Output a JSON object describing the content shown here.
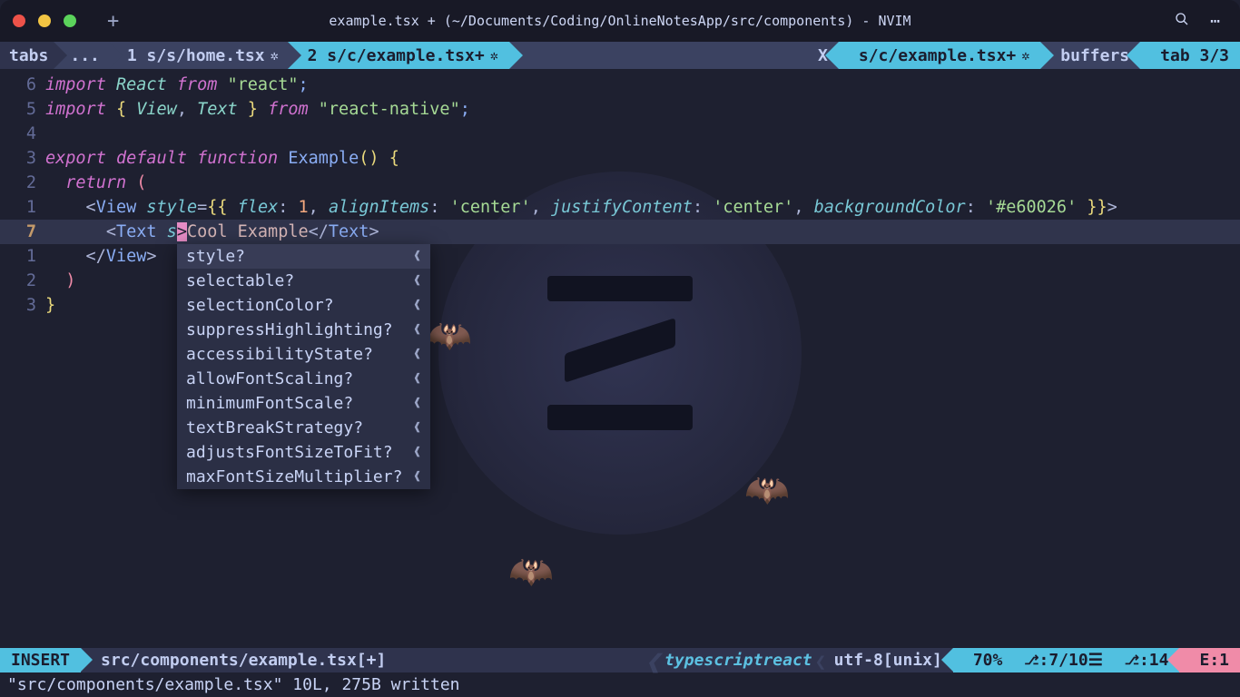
{
  "window": {
    "title": "example.tsx + (~/Documents/Coding/OnlineNotesApp/src/components) - NVIM"
  },
  "tabline": {
    "tabs_label": "tabs",
    "ellipsis": "...",
    "tab1": "1 s/s/home.tsx ",
    "tab2": "2 s/c/example.tsx+ ",
    "close": "X",
    "right_file": "s/c/example.tsx+ ",
    "buffers_label": "buffers",
    "tab_count": "tab 3/3"
  },
  "gutter": [
    "6",
    "5",
    "4",
    "3",
    "2",
    "1",
    "7",
    "1",
    "2",
    "3"
  ],
  "code": {
    "l0": {
      "a": "import ",
      "b": "React ",
      "c": "from ",
      "d": "\"react\"",
      "e": ";"
    },
    "l1": {
      "a": "import ",
      "b": "{ ",
      "c": "View",
      "d": ", ",
      "e": "Text ",
      "f": "} ",
      "g": "from ",
      "h": "\"react-native\"",
      "i": ";"
    },
    "l3": {
      "a": "export ",
      "b": "default ",
      "c": "function ",
      "d": "Example",
      "e": "() {"
    },
    "l4": {
      "a": "  return ",
      "b": "("
    },
    "l5": {
      "a": "    <",
      "b": "View ",
      "c": "style",
      "d": "=",
      "e": "{{ ",
      "f": "flex",
      "g": ": ",
      "h": "1",
      "i": ", ",
      "j": "alignItems",
      "k": ": ",
      "l": "'center'",
      "m": ", ",
      "n": "justifyContent",
      "o": ": ",
      "p": "'center'",
      "q": ", ",
      "r": "backgroundColor",
      "s": ": ",
      "t": "'#e60026'",
      "u": " }}",
      "v": ">"
    },
    "l6": {
      "a": "      <",
      "b": "Text ",
      "c": "s",
      "d": ">",
      "e": "Cool Example",
      "f": "</",
      "g": "Text",
      "h": ">"
    },
    "l7": {
      "a": "    </",
      "b": "View",
      "c": ">"
    },
    "l8": {
      "a": "  )"
    },
    "l9": {
      "a": "}"
    }
  },
  "completion": [
    "style?",
    "selectable?",
    "selectionColor?",
    "suppressHighlighting?",
    "accessibilityState?",
    "allowFontScaling?",
    "minimumFontScale?",
    "textBreakStrategy?",
    "adjustsFontSizeToFit?",
    "maxFontSizeMultiplier?"
  ],
  "statusline": {
    "mode": "INSERT",
    "file": "src/components/example.tsx[+]",
    "lsp": "typescriptreact",
    "encoding": "utf-8[unix]",
    "percent": "70%",
    "line": ":7/10",
    "bars": "☰",
    "col": ":14",
    "diag": "E:1"
  },
  "cmdline": "\"src/components/example.tsx\" 10L, 275B written"
}
